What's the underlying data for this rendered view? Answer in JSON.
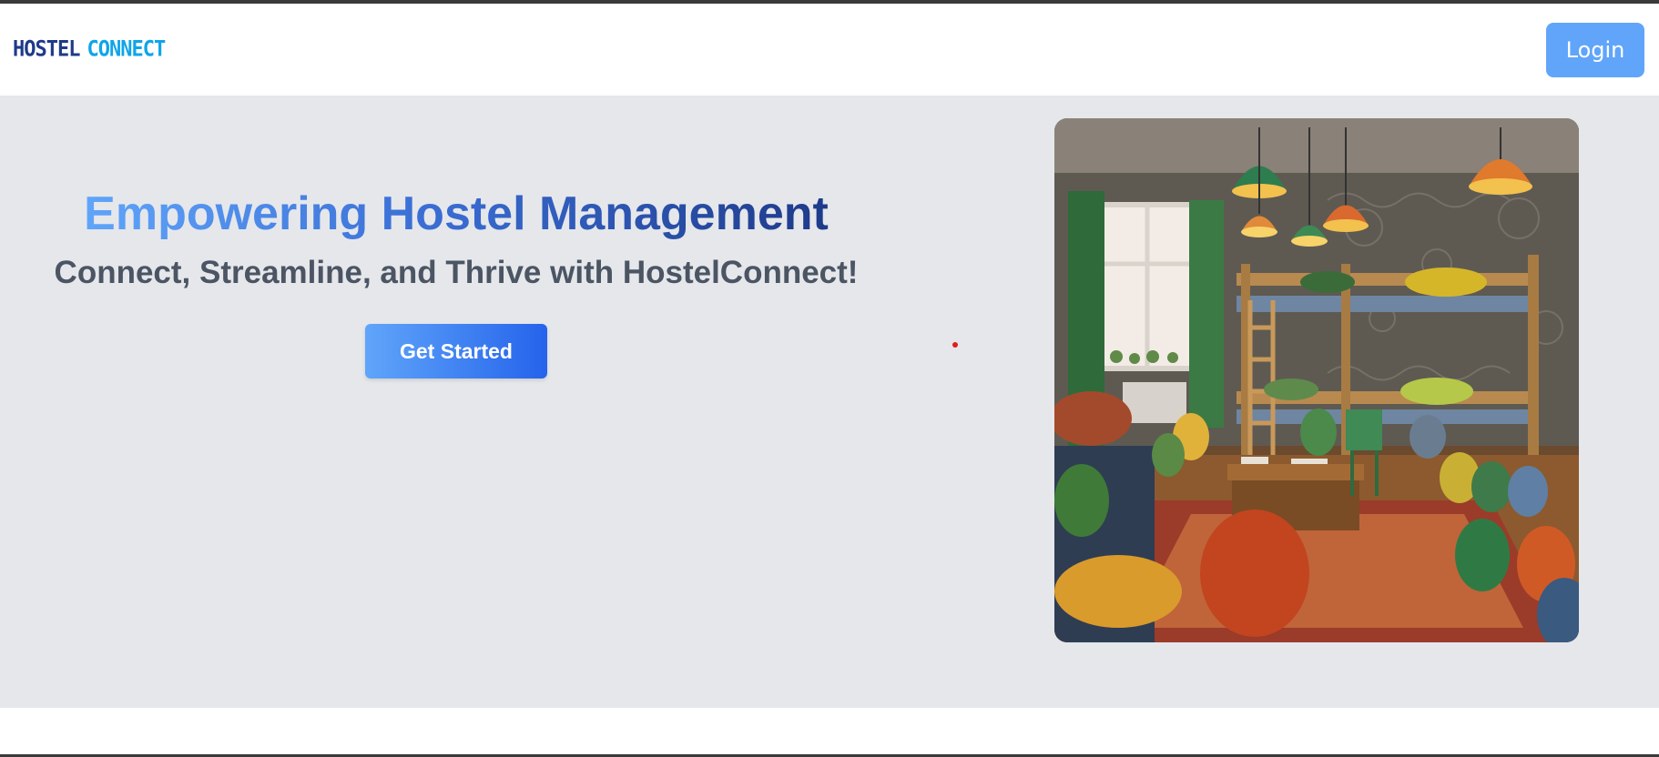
{
  "brand": {
    "logo_word1": "HOSTEL",
    "logo_word2": "CONNECT"
  },
  "nav": {
    "login_label": "Login"
  },
  "hero": {
    "title": "Empowering Hostel Management",
    "subtitle": "Connect, Streamline, and Thrive with HostelConnect!",
    "cta_label": "Get Started",
    "image_subject": "hostel-dorm-room-photo"
  },
  "colors": {
    "accent": "#60a5fa",
    "accent_dark": "#2563eb",
    "brand_navy": "#1e3a8a",
    "hero_bg": "#e5e7eb",
    "subtitle_gray": "#4b5563"
  }
}
